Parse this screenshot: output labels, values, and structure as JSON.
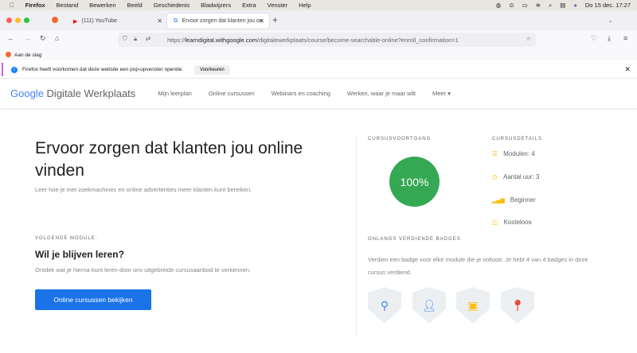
{
  "menubar": {
    "app": "Firefox",
    "items": [
      "Bestand",
      "Bewerken",
      "Beeld",
      "Geschiedenis",
      "Bladwijzers",
      "Extra",
      "Venster",
      "Help"
    ],
    "clock": "Do 15 dec.  17:27"
  },
  "tabs": [
    {
      "label": "(111) YouTube"
    },
    {
      "label": "Ervoor zorgen dat klanten jou on"
    }
  ],
  "url": {
    "domain": "learndigital.withgoogle.com",
    "prefix": "https://",
    "path": "/digitalewerkplaats/course/become-searchable-online?enroll_confirmation=1"
  },
  "bookmarks": {
    "item": "Aan de slag"
  },
  "notification": {
    "text": "Firefox heeft voorkomen dat deze website een pop-upvenster opende.",
    "button": "Voorkeuren"
  },
  "site": {
    "logo_google": "Google",
    "logo_text": "Digitale Werkplaats",
    "nav": [
      "Mijn leerplan",
      "Online cursussen",
      "Webinars en coaching",
      "Werken, waar je maar wilt",
      "Meer"
    ]
  },
  "course": {
    "title": "Ervoor zorgen dat klanten jou online vinden",
    "subtitle": "Leer hoe je met zoekmachines en online advertenties meer klanten kunt bereiken.",
    "next_label": "VOLGENDE MODULE:",
    "next_title": "Wil je blijven leren?",
    "next_text": "Ontdek wat je hierna kunt leren door ons uitgebreide cursusaanbod te verkennen.",
    "cta": "Online cursussen bekijken"
  },
  "progress": {
    "label": "CURSUSVOORTGANG",
    "value": "100%",
    "percent": 100,
    "color": "#34a853"
  },
  "details": {
    "label": "CURSUSDETAILS",
    "items": [
      "Modulen: 4",
      "Aantal uur: 3",
      "Beginner",
      "Kosteloos"
    ]
  },
  "badges": {
    "label": "ONLANGS VERDIENDE BADGES",
    "text": "Verdien een badge voor elke module die je voltooit. Je hebt 4 van 4 badges in deze cursus verdiend."
  }
}
